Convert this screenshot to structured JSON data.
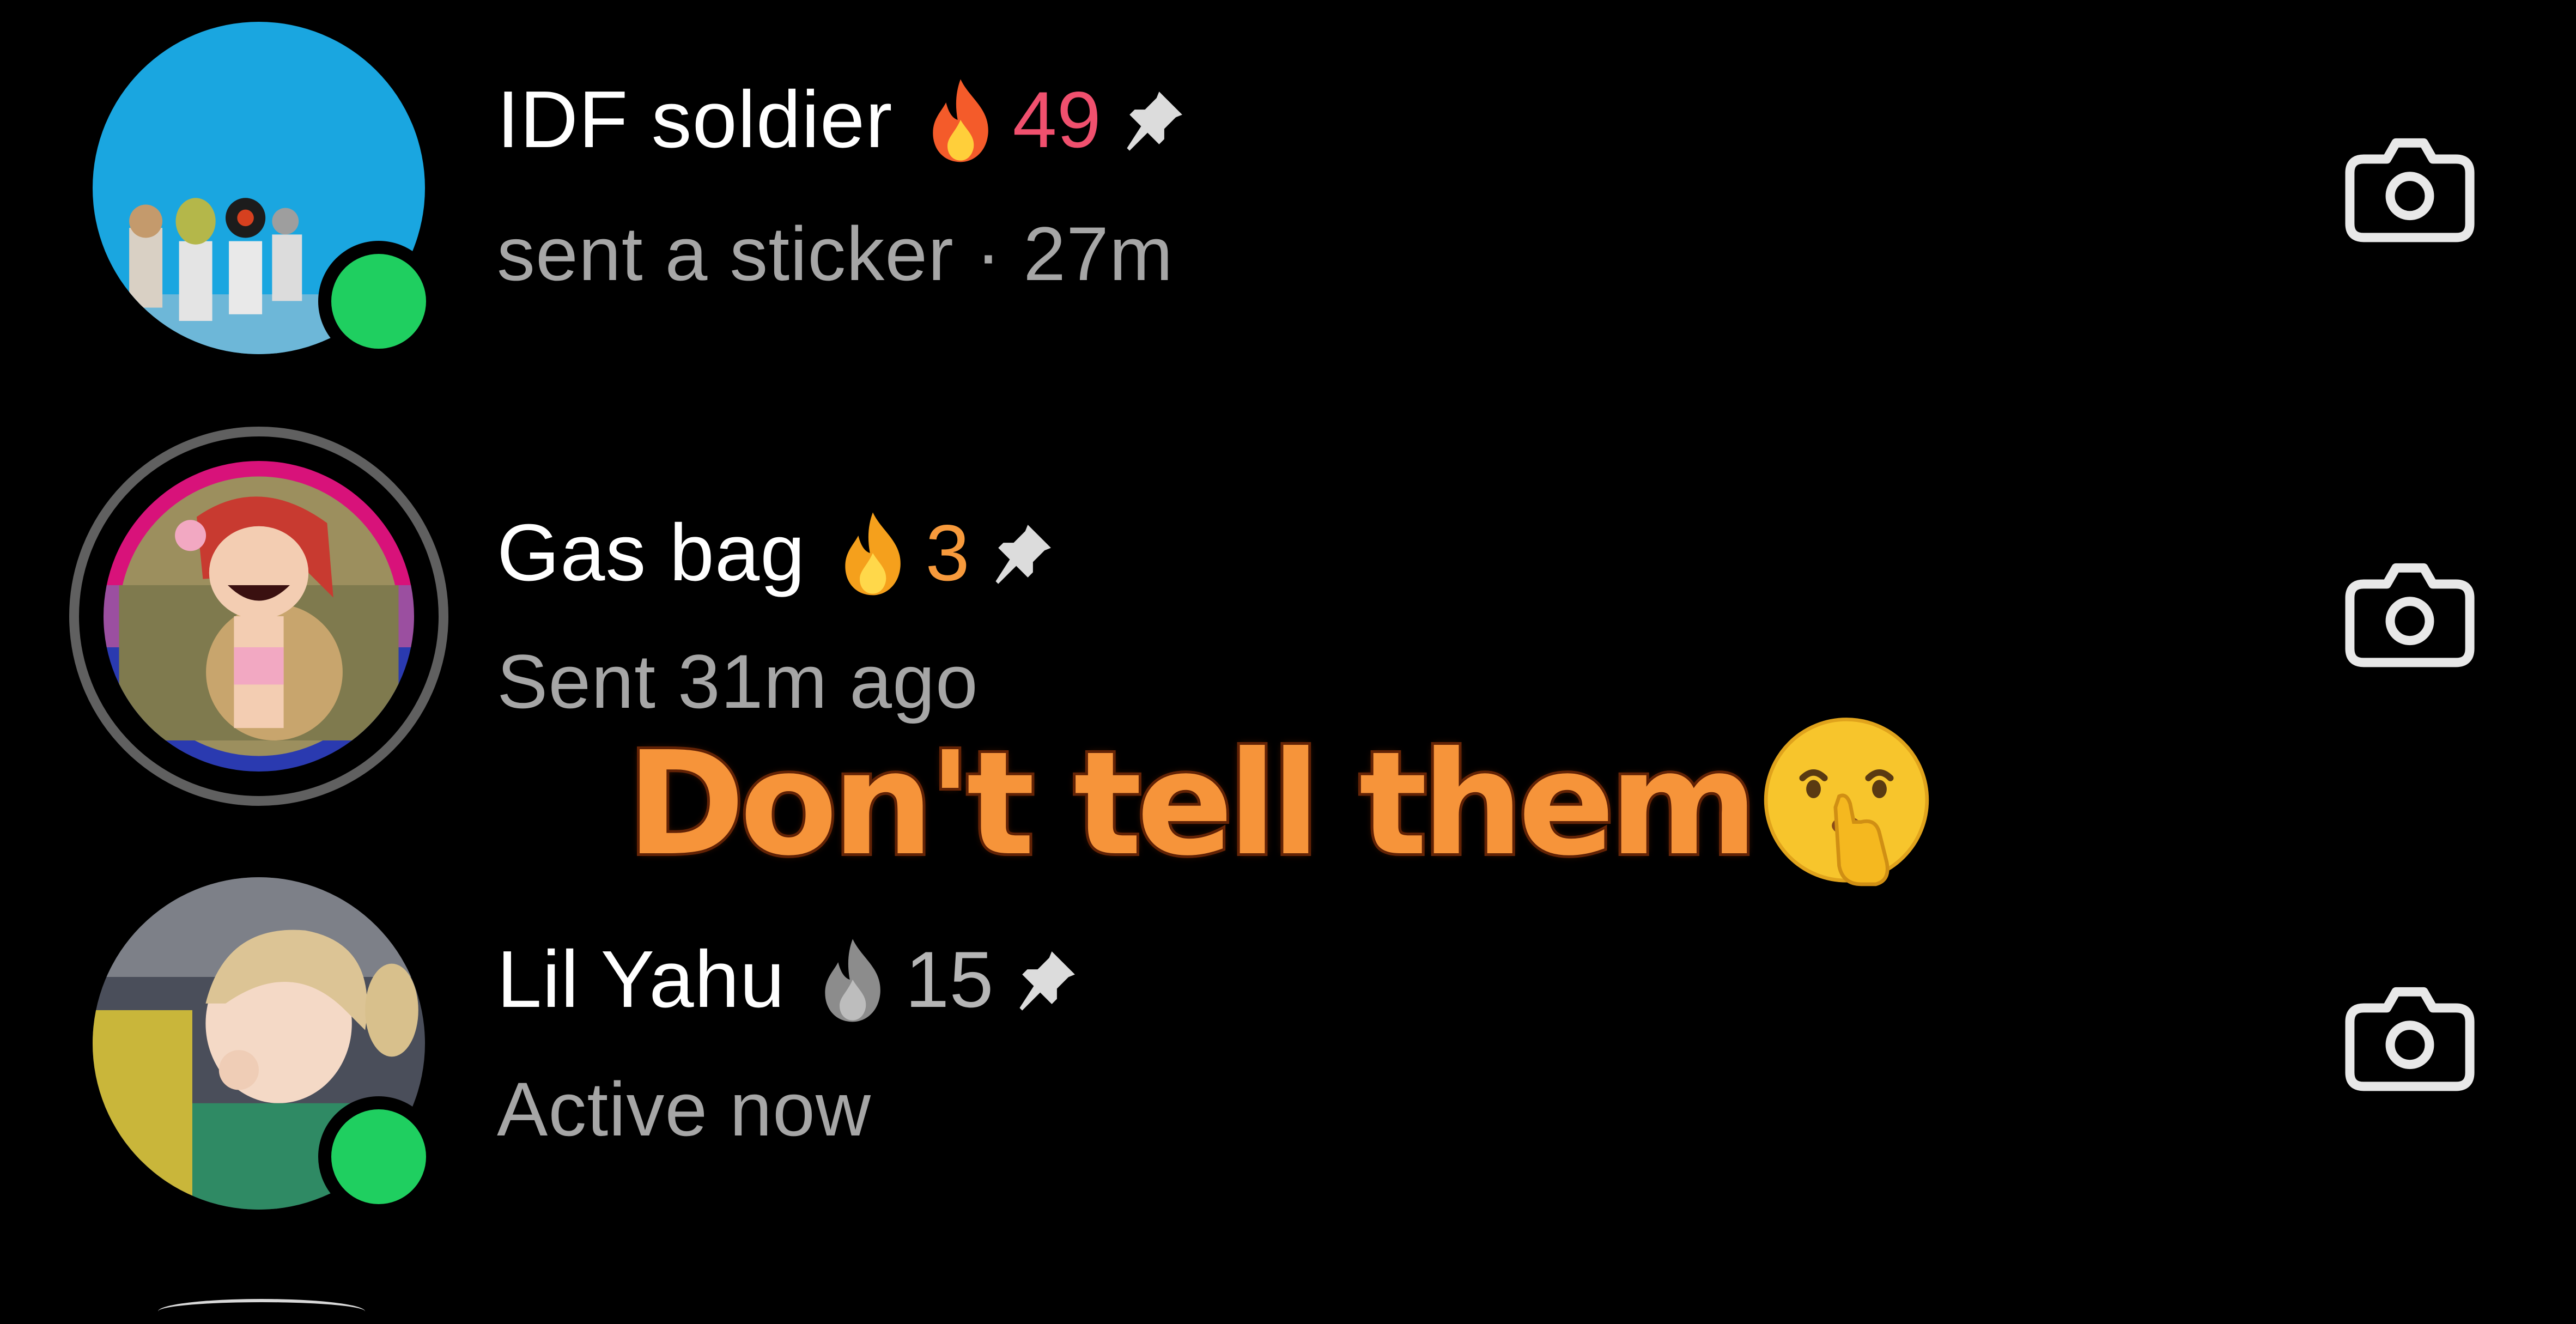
{
  "chats": [
    {
      "name": "IDF soldier",
      "streak": "49",
      "streak_color": "#f0506e",
      "flame_icon": "fire-streak-icon",
      "pin_icon": "pin-icon",
      "status": "sent a sticker · 27m",
      "online": true,
      "camera_icon": "camera-icon"
    },
    {
      "name": "Gas bag",
      "streak": "3",
      "streak_color": "#f79a3c",
      "flame_icon": "fire-streak-icon",
      "pin_icon": "pin-icon",
      "status": "Sent 31m ago",
      "online": false,
      "camera_icon": "camera-icon"
    },
    {
      "name": "Lil Yahu",
      "streak": "15",
      "streak_color": "#b5b5b5",
      "flame_icon": "fading-fire-streak-icon",
      "pin_icon": "pin-icon",
      "status": "Active now",
      "online": true,
      "camera_icon": "camera-icon"
    }
  ],
  "overlay": {
    "caption": "Don't tell them",
    "emoji": "shushing-face-emoji",
    "caption_color": "#f6943a"
  },
  "colors": {
    "background": "#000000",
    "online": "#1fcf60",
    "status_text": "#a6a6a6"
  }
}
